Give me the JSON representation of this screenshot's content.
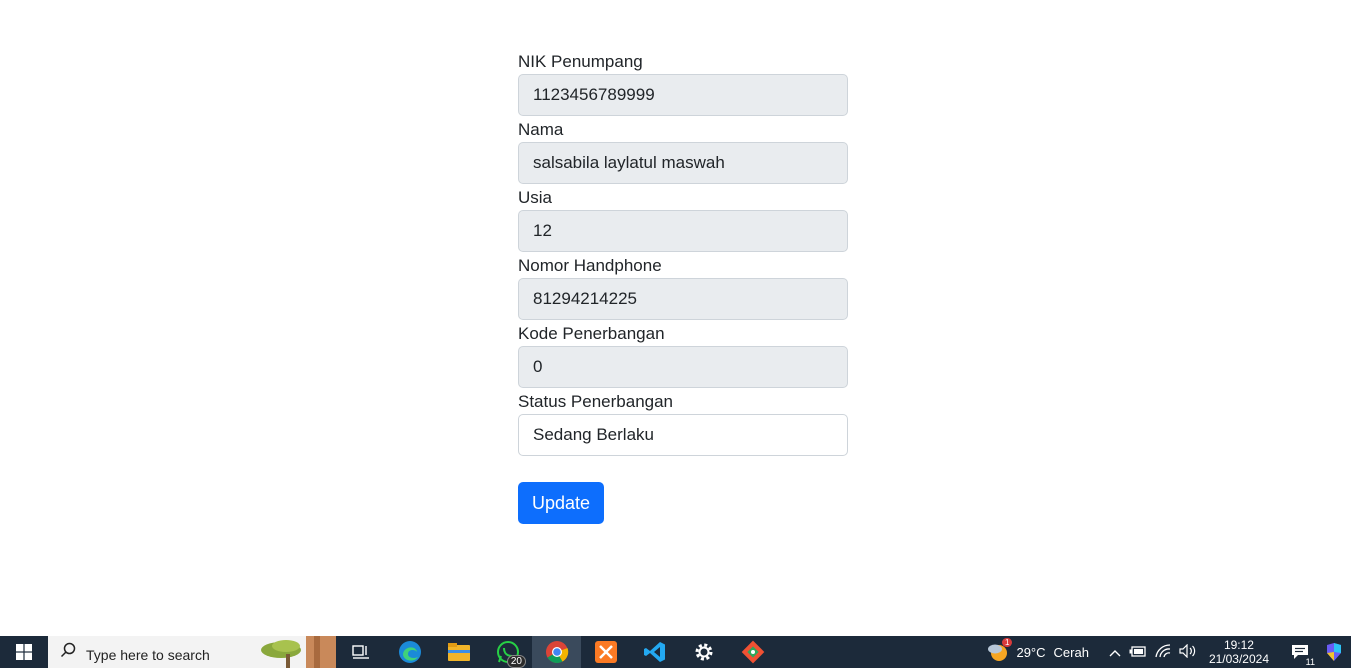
{
  "form": {
    "fields": [
      {
        "label": "NIK Penumpang",
        "value": "1123456789999"
      },
      {
        "label": "Nama",
        "value": "salsabila laylatul maswah"
      },
      {
        "label": "Usia",
        "value": "12"
      },
      {
        "label": "Nomor Handphone",
        "value": "81294214225"
      },
      {
        "label": "Kode Penerbangan",
        "value": "0"
      },
      {
        "label": "Status Penerbangan",
        "value": "Sedang Berlaku"
      }
    ],
    "update_label": "Update"
  },
  "taskbar": {
    "search_placeholder": "Type here to search",
    "whatsapp_badge": "20",
    "weather_badge": "1",
    "weather_temp": "29°C",
    "weather_cond": "Cerah",
    "clock_time": "19:12",
    "clock_date": "21/03/2024",
    "notif_count": "11",
    "icons": [
      "windows-icon",
      "search-icon",
      "task-view-icon",
      "edge-icon",
      "file-explorer-icon",
      "whatsapp-icon",
      "chrome-icon",
      "xampp-icon",
      "vscode-icon",
      "settings-icon",
      "git-icon"
    ]
  },
  "colors": {
    "primary": "#0d6efd",
    "readonly_bg": "#e9ecef",
    "taskbar_bg": "#1c2a3a"
  }
}
